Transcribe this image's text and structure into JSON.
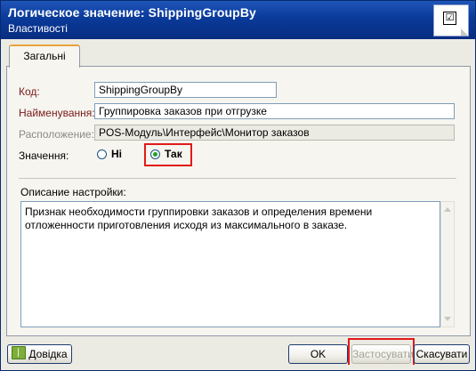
{
  "header": {
    "title": "Логическое значение:  ShippingGroupBy",
    "subtitle": "Властивості",
    "icon": "checkbox-icon",
    "icon_glyph": "☑"
  },
  "tabs": [
    {
      "label": "Загальні",
      "active": true
    }
  ],
  "form": {
    "code_label": "Код:",
    "code_value": "ShippingGroupBy",
    "name_label": "Найменування:",
    "name_value": "Группировка заказов при отгрузке",
    "location_label": "Расположение:",
    "location_value": "POS-Модуль\\Интерфейс\\Монитор заказов",
    "value_label": "Значення:",
    "options": [
      {
        "label": "Ні",
        "selected": false
      },
      {
        "label": "Так",
        "selected": true
      }
    ],
    "description_label": "Описание настройки:",
    "description_text": "Признак необходимости группировки заказов и определения времени отложенности приготовления исходя из максимального в заказе."
  },
  "buttons": {
    "help": "Довідка",
    "ok": "OK",
    "apply": "Застосувати",
    "apply_enabled": false,
    "cancel": "Скасувати"
  },
  "colors": {
    "header_bg": "#0a3a9a",
    "highlight": "#e11a1a",
    "required_label": "#7a1a1a",
    "tab_accent": "#e8a33a"
  }
}
